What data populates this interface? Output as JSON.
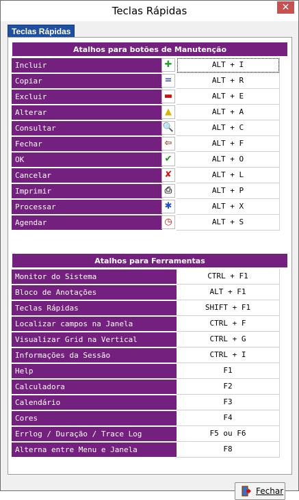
{
  "window": {
    "title": "Teclas Rápidas",
    "close_glyph": "✕"
  },
  "tab": {
    "label": "Teclas Rápidas"
  },
  "section1": {
    "header": "Atalhos para botões de Manutenção",
    "items": [
      {
        "label": "Incluir",
        "key": "ALT + I",
        "icon": "plus-icon",
        "glyph": "✚",
        "color": "#2e9e2e"
      },
      {
        "label": "Copiar",
        "key": "ALT + R",
        "icon": "copy-icon",
        "glyph": "=",
        "color": "#2a4fc4"
      },
      {
        "label": "Excluir",
        "key": "ALT + E",
        "icon": "minus-icon",
        "glyph": "▬",
        "color": "#cc1111"
      },
      {
        "label": "Alterar",
        "key": "ALT + A",
        "icon": "edit-icon",
        "glyph": "▲",
        "color": "#e0b000"
      },
      {
        "label": "Consultar",
        "key": "ALT + C",
        "icon": "magnifier-icon",
        "glyph": "🔍",
        "color": "#222222"
      },
      {
        "label": "Fechar",
        "key": "ALT + F",
        "icon": "exit-door-icon",
        "glyph": "⇦",
        "color": "#8b3a1a"
      },
      {
        "label": "OK",
        "key": "ALT + O",
        "icon": "check-icon",
        "glyph": "✔",
        "color": "#1e8e1e"
      },
      {
        "label": "Cancelar",
        "key": "ALT + L",
        "icon": "cancel-icon",
        "glyph": "✘",
        "color": "#d31a1a"
      },
      {
        "label": "Imprimir",
        "key": "ALT + P",
        "icon": "printer-icon",
        "glyph": "⎙",
        "color": "#333333"
      },
      {
        "label": "Processar",
        "key": "ALT + X",
        "icon": "gears-icon",
        "glyph": "✱",
        "color": "#1f4fcf"
      },
      {
        "label": "Agendar",
        "key": "ALT + S",
        "icon": "clock-icon",
        "glyph": "◷",
        "color": "#cc1111"
      }
    ]
  },
  "section2": {
    "header": "Atalhos para Ferramentas",
    "items": [
      {
        "label": "Monitor do Sistema",
        "key": "CTRL + F1"
      },
      {
        "label": "Bloco de Anotações",
        "key": "ALT + F1"
      },
      {
        "label": "Teclas Rápidas",
        "key": "SHIFT + F1"
      },
      {
        "label": "Localizar campos na Janela",
        "key": "CTRL + F"
      },
      {
        "label": "Visualizar Grid na Vertical",
        "key": "CTRL + G"
      },
      {
        "label": "Informações da Sessão",
        "key": "CTRL + I"
      },
      {
        "label": "Help",
        "key": "F1"
      },
      {
        "label": "Calculadora",
        "key": "F2"
      },
      {
        "label": "Calendário",
        "key": "F3"
      },
      {
        "label": "Cores",
        "key": "F4"
      },
      {
        "label": "Errlog / Duração / Trace Log",
        "key": "F5 ou F6"
      },
      {
        "label": "Alterna entre Menu e Janela",
        "key": "F8"
      }
    ]
  },
  "footer": {
    "fechar_label": "Fechar",
    "fechar_icon": "exit-door-icon"
  },
  "colors": {
    "accent": "#74207e",
    "tab": "#1f4fa0",
    "close": "#c75050"
  }
}
